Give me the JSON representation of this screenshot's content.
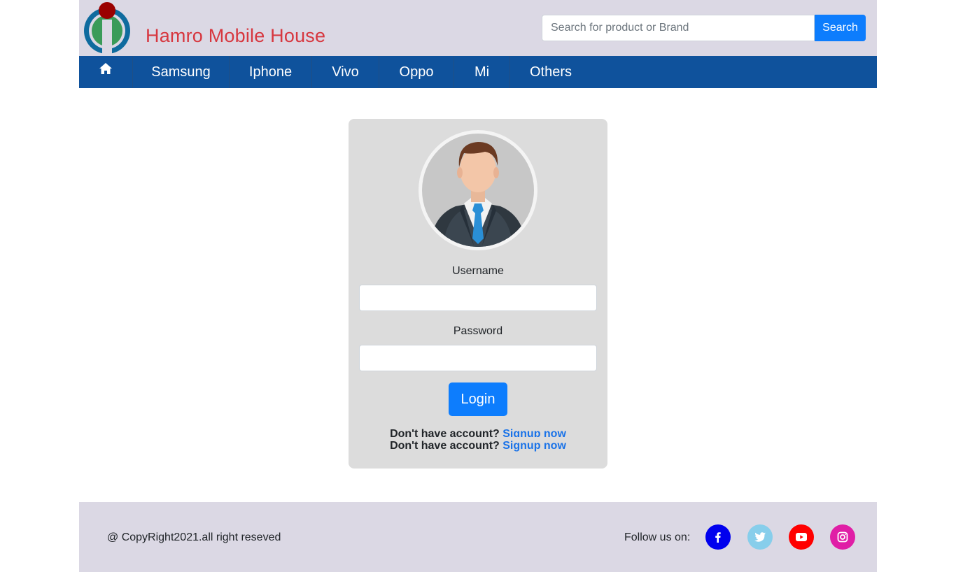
{
  "header": {
    "brand_name": "Hamro Mobile House",
    "search_placeholder": "Search for product or Brand",
    "search_button_label": "Search"
  },
  "nav": {
    "home_icon": "home-icon",
    "items": [
      {
        "label": "Samsung"
      },
      {
        "label": "Iphone"
      },
      {
        "label": "Vivo"
      },
      {
        "label": "Oppo"
      },
      {
        "label": "Mi"
      },
      {
        "label": "Others"
      }
    ]
  },
  "login": {
    "avatar_icon": "user-avatar",
    "username_label": "Username",
    "password_label": "Password",
    "login_button_label": "Login",
    "signup_prompt": "Don't have account?",
    "signup_link": "Signup now"
  },
  "footer": {
    "copyright": "@ CopyRight2021.all right reseved",
    "follow_label": "Follow us on:",
    "social": [
      {
        "name": "facebook-icon",
        "color": "#0000ee"
      },
      {
        "name": "twitter-icon",
        "color": "#87ceeb"
      },
      {
        "name": "youtube-icon",
        "color": "#ff0000"
      },
      {
        "name": "instagram-icon",
        "color": "#e01ea6"
      }
    ]
  },
  "colors": {
    "brand_text": "#d7373f",
    "header_bg": "#dbd8e4",
    "nav_bg": "#0f529c",
    "primary_button": "#0d7dfd",
    "card_bg": "#dcdcdc"
  }
}
